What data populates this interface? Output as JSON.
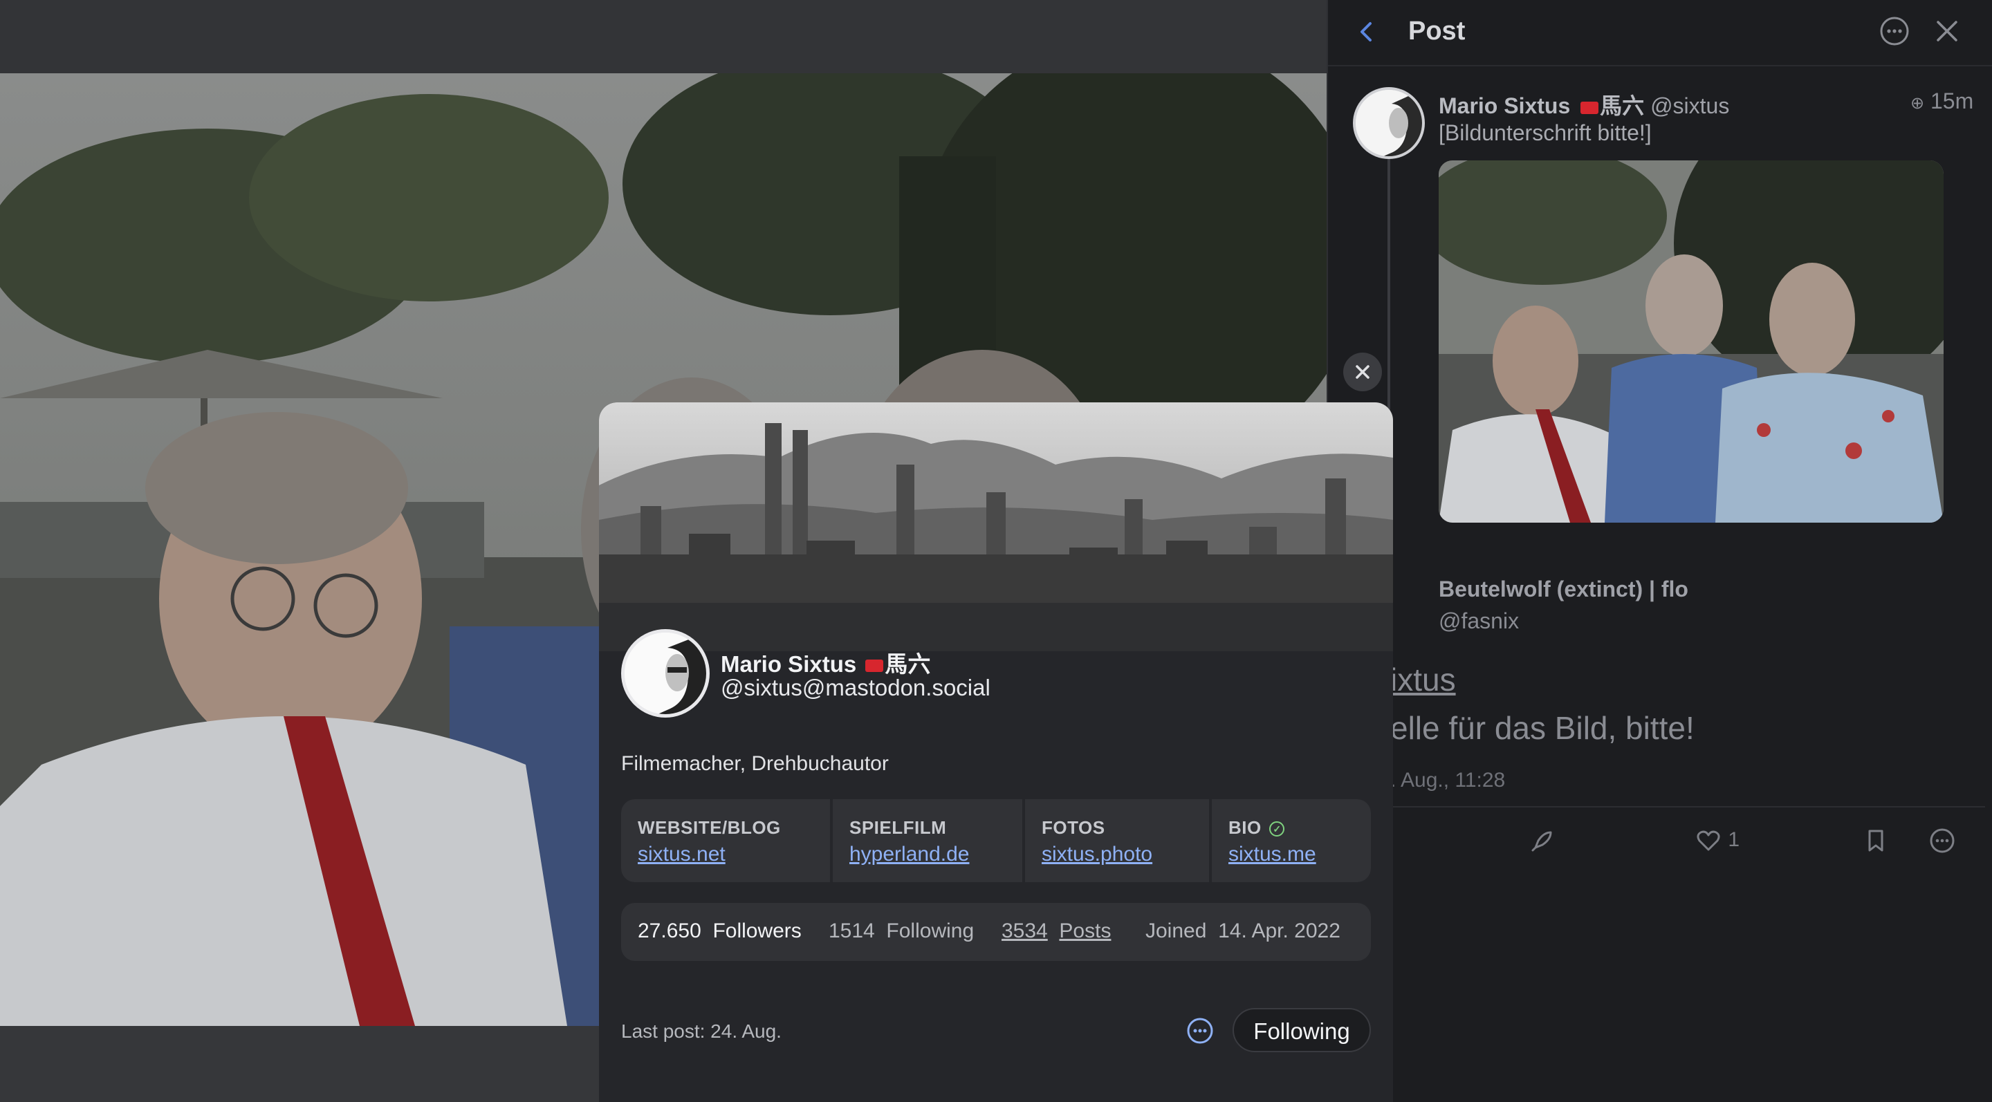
{
  "panel": {
    "title": "Post",
    "post": {
      "author_name": "Mario Sixtus",
      "author_suffix": "馬六",
      "author_handle": "@sixtus",
      "time": "15m",
      "text": "[Bildunterschrift bitte!]"
    },
    "reply": {
      "author": "Beutelwolf (extinct) | flo",
      "handle": "@fasnix",
      "mention": "ixtus",
      "text": "elle für das Bild, bitte!",
      "date": ". Aug., 11:28",
      "likes": "1"
    }
  },
  "profile": {
    "name": "Mario Sixtus",
    "name_suffix": "馬六",
    "handle": "@sixtus@mastodon.social",
    "bio": "Filmemacher, Drehbuchautor",
    "fields": [
      {
        "label": "WEBSITE/BLOG",
        "value": "sixtus.net"
      },
      {
        "label": "SPIELFILM",
        "value": "hyperland.de"
      },
      {
        "label": "FOTOS",
        "value": "sixtus.photo"
      },
      {
        "label": "BIO",
        "value": "sixtus.me"
      }
    ],
    "stats": {
      "followers_count": "27.650",
      "followers_label": "Followers",
      "following_count": "1514",
      "following_label": "Following",
      "posts_count": "3534",
      "posts_label": "Posts",
      "joined_label": "Joined",
      "joined_date": "14. Apr. 2022"
    },
    "last_post": "Last post: 24. Aug.",
    "follow_label": "Following"
  },
  "colors": {
    "accent": "#8fb1f5",
    "panel_bg": "#1c1d20",
    "popup_bg": "#25262a",
    "verified": "#7fd27f"
  }
}
